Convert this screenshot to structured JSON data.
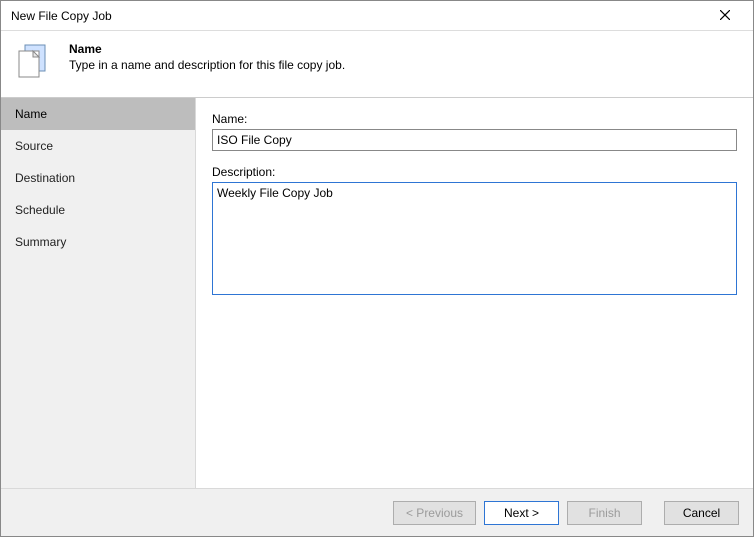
{
  "window": {
    "title": "New File Copy Job"
  },
  "header": {
    "heading": "Name",
    "subtext": "Type in a name and description for this file copy job."
  },
  "sidebar": {
    "items": [
      {
        "label": "Name"
      },
      {
        "label": "Source"
      },
      {
        "label": "Destination"
      },
      {
        "label": "Schedule"
      },
      {
        "label": "Summary"
      }
    ]
  },
  "form": {
    "name_label": "Name:",
    "name_value": "ISO File Copy",
    "desc_label": "Description:",
    "desc_value": "Weekly File Copy Job"
  },
  "footer": {
    "previous": "< Previous",
    "next": "Next >",
    "finish": "Finish",
    "cancel": "Cancel"
  }
}
